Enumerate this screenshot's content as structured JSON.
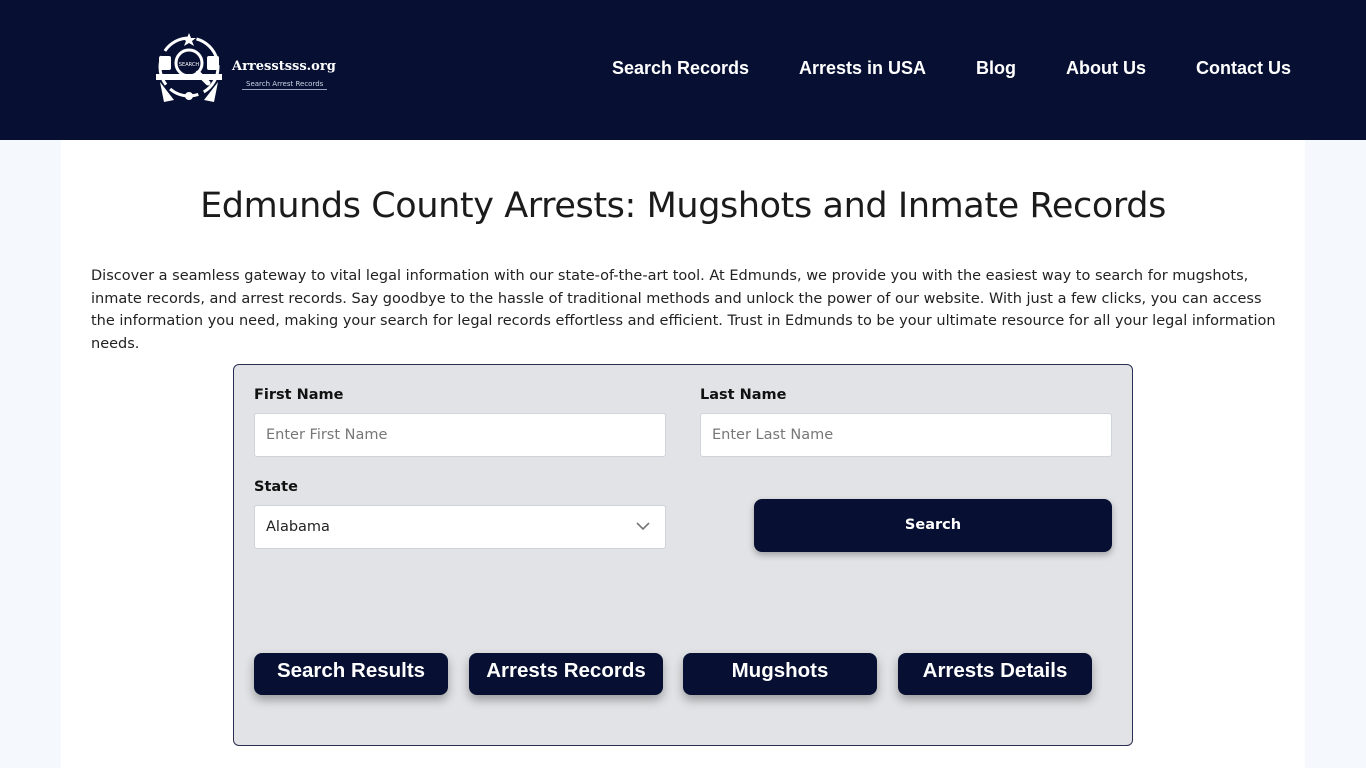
{
  "header": {
    "logo_title": "Arresstsss.org",
    "logo_subtitle": "Search Arrest Records",
    "logo_badge": "SEARCH",
    "nav": [
      {
        "label": "Search Records"
      },
      {
        "label": "Arrests in USA"
      },
      {
        "label": "Blog"
      },
      {
        "label": "About Us"
      },
      {
        "label": "Contact Us"
      }
    ]
  },
  "page": {
    "title": "Edmunds County Arrests: Mugshots and Inmate Records",
    "intro": "Discover a seamless gateway to vital legal information with our state-of-the-art tool. At Edmunds, we provide you with the easiest way to search for mugshots, inmate records, and arrest records. Say goodbye to the hassle of traditional methods and unlock the power of our website. With just a few clicks, you can access the information you need, making your search for legal records effortless and efficient. Trust in Edmunds to be your ultimate resource for all your legal information needs."
  },
  "search_form": {
    "first_name_label": "First Name",
    "first_name_placeholder": "Enter First Name",
    "first_name_value": "",
    "last_name_label": "Last Name",
    "last_name_placeholder": "Enter Last Name",
    "last_name_value": "",
    "state_label": "State",
    "state_value": "Alabama",
    "search_button": "Search"
  },
  "quick_links": [
    {
      "label": "Search Results"
    },
    {
      "label": "Arrests Records"
    },
    {
      "label": "Mugshots"
    },
    {
      "label": "Arrests Details"
    }
  ],
  "colors": {
    "navy": "#071033",
    "form_bg": "#e2e3e6",
    "page_bg": "#f5f8fc"
  }
}
